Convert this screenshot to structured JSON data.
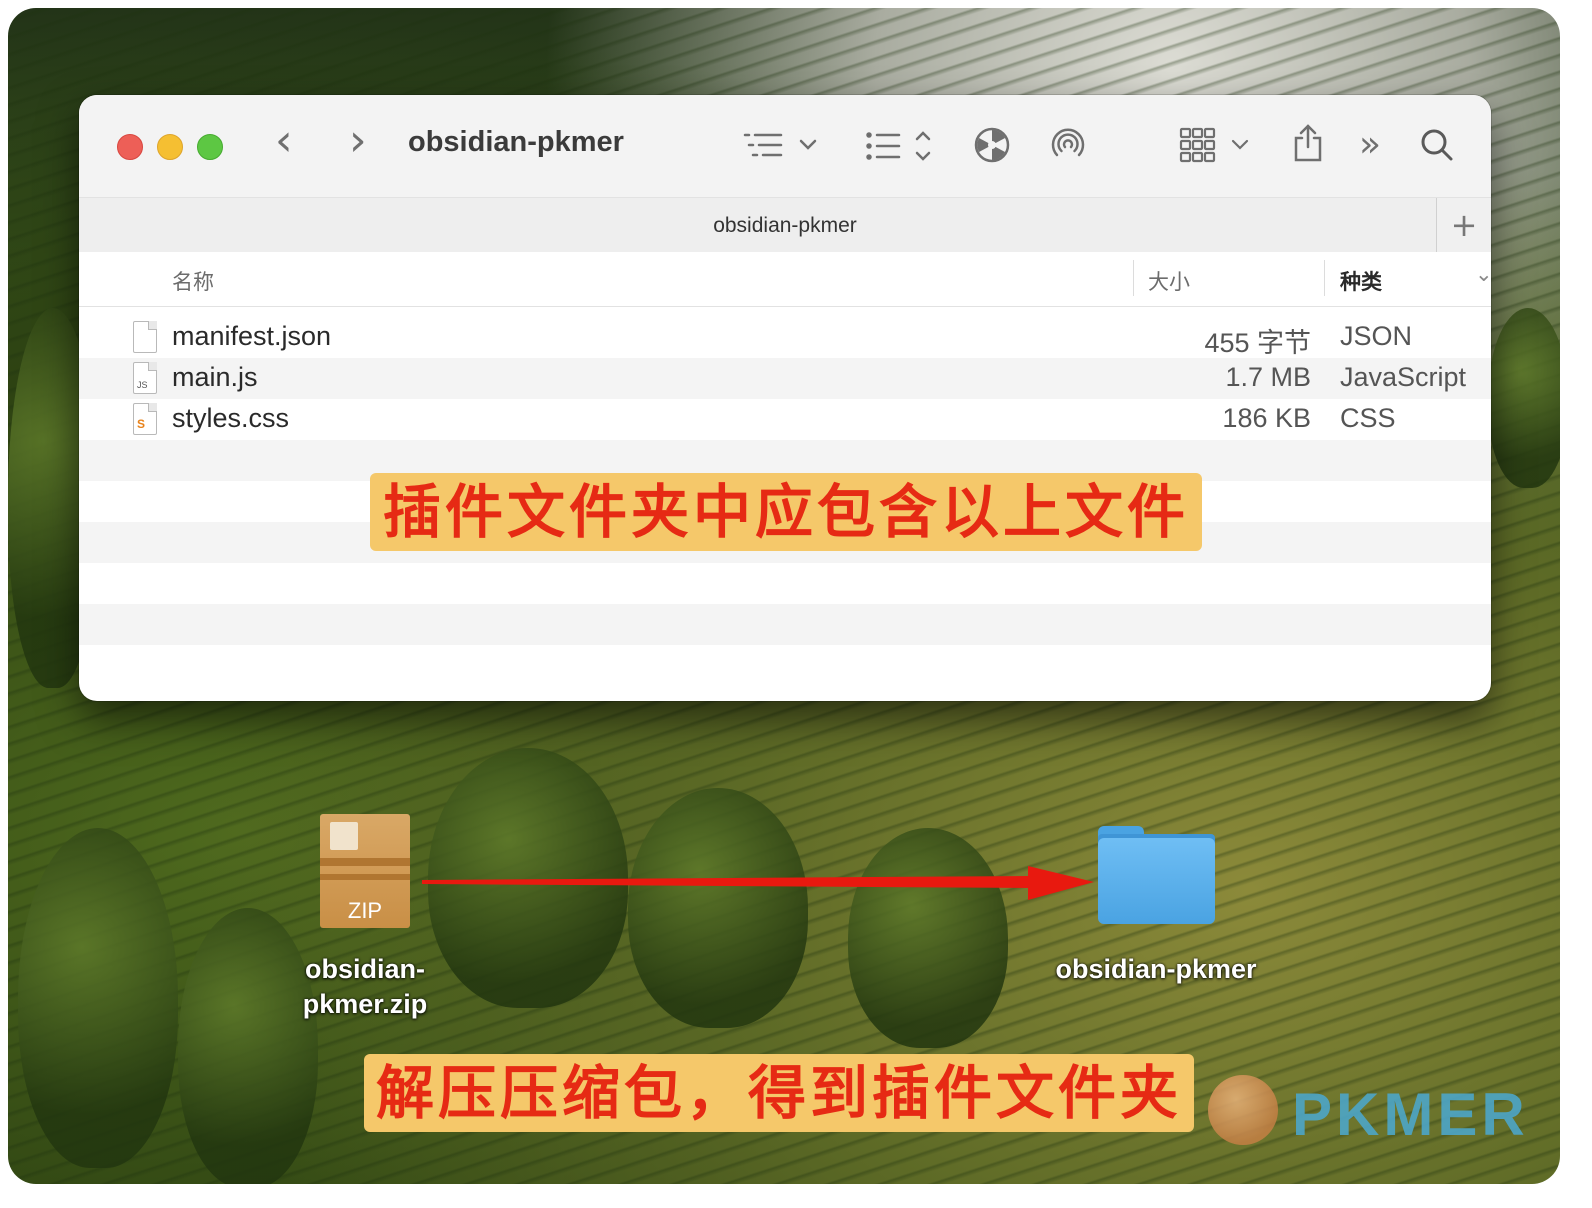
{
  "window": {
    "title": "obsidian-pkmer",
    "path_title": "obsidian-pkmer",
    "toolbar": {
      "back_glyph": "‹",
      "forward_glyph": "›",
      "view_icon": "list-view-icon",
      "group_icon": "sort-list-icon",
      "burn_icon": "burn-icon",
      "airdrop_icon": "airdrop-icon",
      "gallery_icon": "icon-grid-icon",
      "share_icon": "share-icon",
      "more_glyph": "»",
      "search_icon": "search-icon",
      "add_tab": "+"
    },
    "columns": {
      "name": "名称",
      "size": "大小",
      "kind": "种类"
    },
    "files": [
      {
        "name": "manifest.json",
        "size": "455 字节",
        "kind": "JSON",
        "icon": "json-file-icon"
      },
      {
        "name": "main.js",
        "size": "1.7 MB",
        "kind": "JavaScript",
        "icon": "js-file-icon"
      },
      {
        "name": "styles.css",
        "size": "186 KB",
        "kind": "CSS",
        "icon": "css-file-icon"
      }
    ]
  },
  "annotations": {
    "top_banner": "插件文件夹中应包含以上文件",
    "bottom_banner": "解压压缩包，得到插件文件夹"
  },
  "desktop": {
    "zip_file": {
      "label_line1": "obsidian-",
      "label_line2": "pkmer.zip",
      "badge": "ZIP"
    },
    "folder": {
      "label": "obsidian-pkmer"
    }
  },
  "watermark": {
    "text": "PKMER"
  },
  "colors": {
    "annotation_bg": "#f5c86a",
    "annotation_text": "#e62a14",
    "arrow": "#e8190f",
    "folder_blue": "#4aa3e2"
  }
}
